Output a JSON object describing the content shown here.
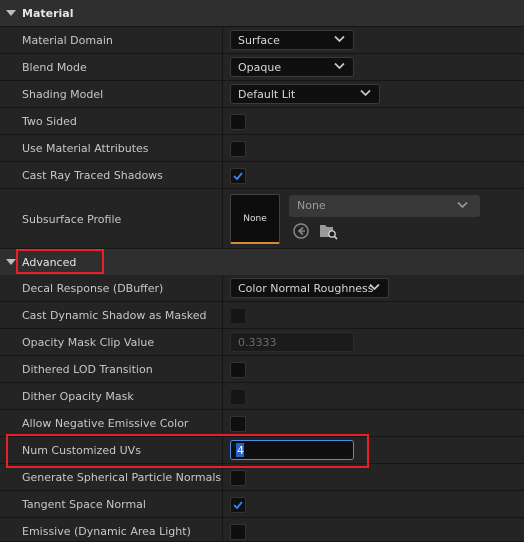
{
  "material_category": {
    "label": "Material"
  },
  "material_rows": {
    "material_domain": {
      "label": "Material Domain",
      "value": "Surface"
    },
    "blend_mode": {
      "label": "Blend Mode",
      "value": "Opaque"
    },
    "shading_model": {
      "label": "Shading Model",
      "value": "Default Lit"
    },
    "two_sided": {
      "label": "Two Sided",
      "checked": false
    },
    "use_material_attributes": {
      "label": "Use Material Attributes",
      "checked": false
    },
    "cast_ray_traced_shadows": {
      "label": "Cast Ray Traced Shadows",
      "checked": true
    },
    "subsurface_profile": {
      "label": "Subsurface Profile",
      "thumbnail_text": "None",
      "value": "None"
    }
  },
  "advanced_category": {
    "label": "Advanced"
  },
  "advanced_rows": {
    "decal_response": {
      "label": "Decal Response (DBuffer)",
      "value": "Color Normal Roughness"
    },
    "cast_dynamic_shadow_as_masked": {
      "label": "Cast Dynamic Shadow as Masked",
      "checked": false
    },
    "opacity_mask_clip_value": {
      "label": "Opacity Mask Clip Value",
      "value": "0.3333"
    },
    "dithered_lod_transition": {
      "label": "Dithered LOD Transition",
      "checked": false
    },
    "dither_opacity_mask": {
      "label": "Dither Opacity Mask",
      "checked": false
    },
    "allow_negative_emissive_color": {
      "label": "Allow Negative Emissive Color",
      "checked": false
    },
    "num_customized_uvs": {
      "label": "Num Customized UVs",
      "value": "4"
    },
    "generate_spherical_particle_normals": {
      "label": "Generate Spherical Particle Normals",
      "checked": false
    },
    "tangent_space_normal": {
      "label": "Tangent Space Normal",
      "checked": true
    },
    "emissive_dynamic_area_light": {
      "label": "Emissive (Dynamic Area Light)",
      "checked": false
    }
  },
  "colors": {
    "background": "#1c1c1c",
    "row": "#242424",
    "category": "#2f2f2f",
    "checkmark": "#3b82f6",
    "highlight": "#e8202a",
    "accent_orange": "#d88a2c"
  },
  "icons": [
    "chevron-down-icon",
    "checkmark-icon",
    "reset-arrow-icon",
    "browse-folder-icon",
    "expand-triangle-icon"
  ]
}
